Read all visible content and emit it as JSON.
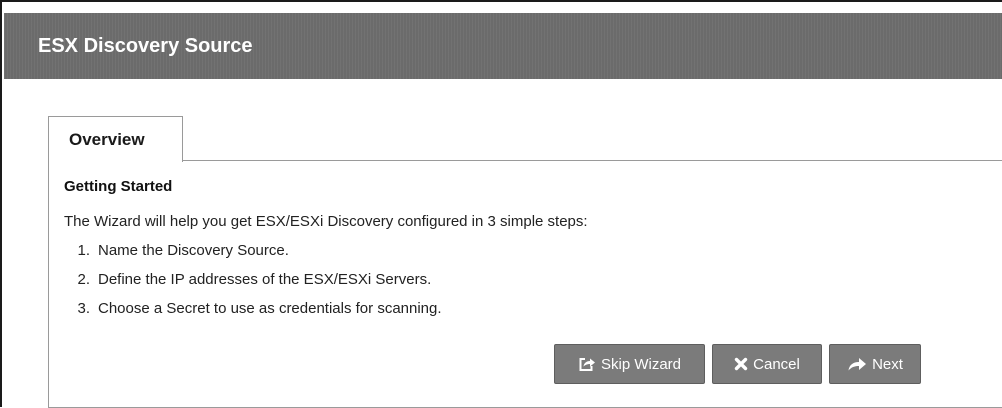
{
  "dialog": {
    "title": "ESX Discovery Source"
  },
  "tabs": [
    {
      "label": "Overview"
    }
  ],
  "overview": {
    "heading": "Getting Started",
    "intro": "The Wizard will help you get ESX/ESXi Discovery configured in 3 simple steps:",
    "steps": [
      {
        "num": "1.",
        "text": "Name the Discovery Source."
      },
      {
        "num": "2.",
        "text": "Define the IP addresses of the ESX/ESXi Servers."
      },
      {
        "num": "3.",
        "text": "Choose a Secret to use as credentials for scanning."
      }
    ]
  },
  "buttons": {
    "skip_label": "Skip Wizard",
    "skip_icon": "share-square-icon",
    "cancel_label": "Cancel",
    "cancel_icon": "times-icon",
    "next_label": "Next",
    "next_icon": "share-arrow-icon"
  },
  "colors": {
    "titlebar": "#6b6b6b",
    "button": "#7b7b7b"
  }
}
